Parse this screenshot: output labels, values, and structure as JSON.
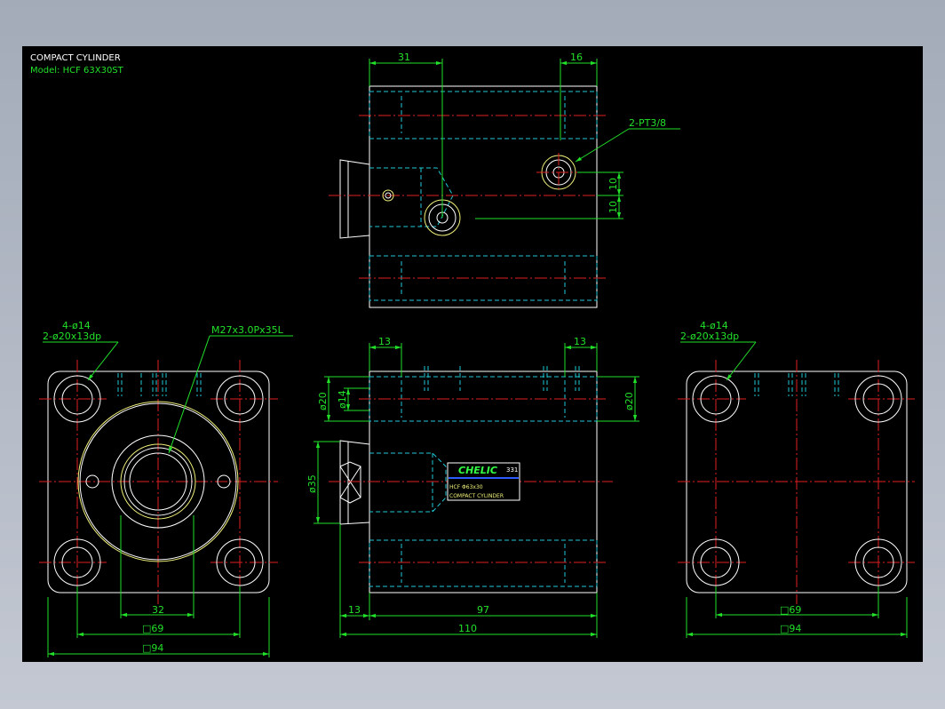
{
  "title_block": {
    "title": "COMPACT CYLINDER",
    "model": "Model: HCF 63X30ST"
  },
  "top_view": {
    "dim_left": "31",
    "dim_right": "16",
    "port_callout": "2-PT3/8",
    "dim_10_upper": "10",
    "dim_10_lower": "10"
  },
  "left_view": {
    "hole_callout_1": "4-ø14",
    "hole_callout_2": "2-ø20x13dp",
    "thread_callout": "M27x3.0Px35L",
    "dim_32": "32",
    "dim_69": "□69",
    "dim_94": "□94"
  },
  "front_view": {
    "dim_13_left": "13",
    "dim_13_right": "13",
    "dim_20_left": "ø20",
    "dim_14": "ø14",
    "dim_20_right": "ø20",
    "dim_35": "ø35",
    "dim_13_bottom": "13",
    "dim_97": "97",
    "dim_110": "110"
  },
  "label_plate": {
    "brand": "CHELIC",
    "badge": "331",
    "model": "HCF Φ63x30",
    "desc": "COMPACT CYLINDER"
  },
  "right_view": {
    "hole_callout_1": "4-ø14",
    "hole_callout_2": "2-ø20x13dp",
    "dim_69": "□69",
    "dim_94": "□94"
  },
  "colors": {
    "background": "#000000",
    "outline": "#ffffff",
    "hidden": "#1fc9d6",
    "center": "#e02020",
    "dimension": "#22e02a",
    "thread": "#f0f07a"
  }
}
